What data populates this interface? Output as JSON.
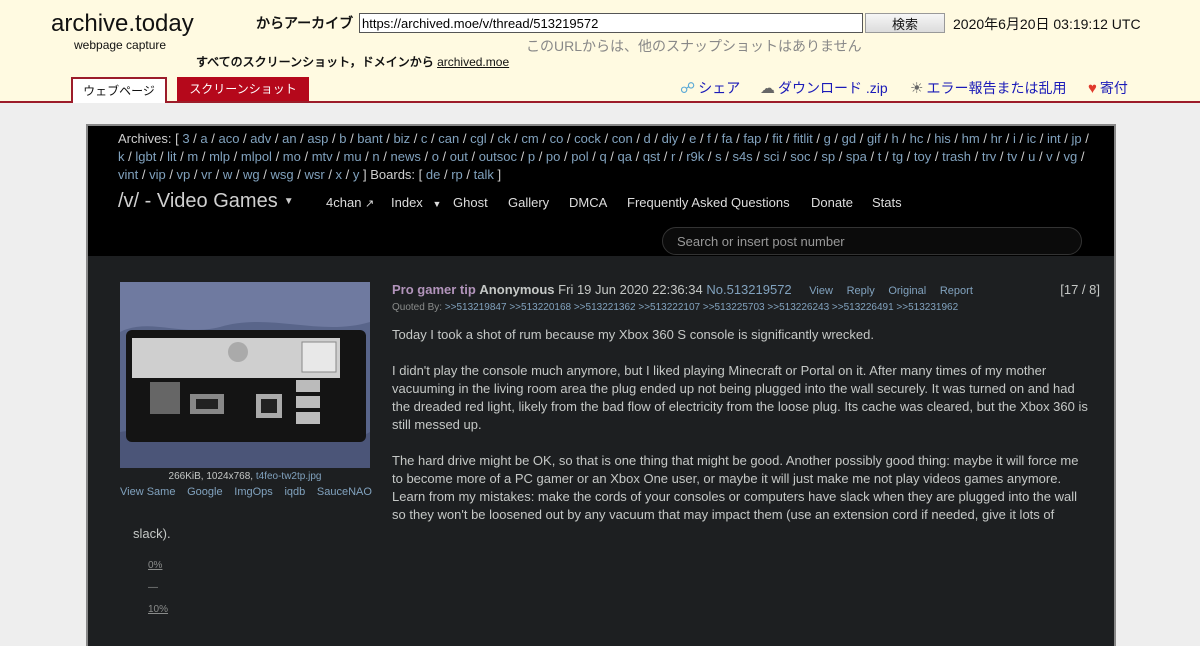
{
  "header": {
    "logo": "archive.today",
    "sublogo": "webpage capture",
    "from_label": "からアーカイブ",
    "url": "https://archived.moe/v/thread/513219572",
    "search_button": "検索",
    "date": "2020年6月20日 03:19:12 UTC",
    "no_snapshots": "このURLからは、他のスナップショットはありません",
    "all_shots_label": "すべてのスクリーンショット，ドメインから",
    "all_shots_domain": "archived.moe",
    "tabs": {
      "webpage": "ウェブページ",
      "screenshot": "スクリーンショット"
    },
    "links": {
      "share": "シェア",
      "download": "ダウンロード .zip",
      "report": "エラー報告または乱用",
      "donate": "寄付"
    }
  },
  "archive": {
    "archives_prefix": "Archives: [",
    "archives": [
      "3",
      "a",
      "aco",
      "adv",
      "an",
      "asp",
      "b",
      "bant",
      "biz",
      "c",
      "can",
      "cgl",
      "ck",
      "cm",
      "co",
      "cock",
      "con",
      "d",
      "diy",
      "e",
      "f",
      "fa",
      "fap",
      "fit",
      "fitlit",
      "g",
      "gd",
      "gif",
      "h",
      "hc",
      "his",
      "hm",
      "hr",
      "i",
      "ic",
      "int",
      "jp",
      "k",
      "lgbt",
      "lit",
      "m",
      "mlp",
      "mlpol",
      "mo",
      "mtv",
      "mu",
      "n",
      "news",
      "o",
      "out",
      "outsoc",
      "p",
      "po",
      "pol",
      "q",
      "qa",
      "qst",
      "r",
      "r9k",
      "s",
      "s4s",
      "sci",
      "soc",
      "sp",
      "spa",
      "t",
      "tg",
      "toy",
      "trash",
      "trv",
      "tv",
      "u",
      "v",
      "vg",
      "vint",
      "vip",
      "vp",
      "vr",
      "w",
      "wg",
      "wsg",
      "wsr",
      "x",
      "y"
    ],
    "boards_prefix": "] Boards: [",
    "boards": [
      "de",
      "rp",
      "talk"
    ],
    "boards_suffix": "]",
    "board_title": "/v/ - Video Games",
    "nav": [
      "4chan",
      "Index",
      "Ghost",
      "Gallery",
      "DMCA",
      "Frequently Asked Questions",
      "Donate",
      "Stats"
    ],
    "search_placeholder": "Search or insert post number"
  },
  "post": {
    "file_meta": "266KiB, 1024x768,",
    "file_name": "t4feo-tw2tp.jpg",
    "image_links": [
      "View Same",
      "Google",
      "ImgOps",
      "iqdb",
      "SauceNAO"
    ],
    "subject": "Pro gamer tip",
    "name": "Anonymous",
    "date": "Fri 19 Jun 2020 22:36:34",
    "number": "No.513219572",
    "actions": [
      "View",
      "Reply",
      "Original",
      "Report"
    ],
    "counter": "[17 / 8]",
    "quoted_by_label": "Quoted By:",
    "quoted_by": [
      ">>513219847",
      ">>513220168",
      ">>513221362",
      ">>513222107",
      ">>513225703",
      ">>513226243",
      ">>513226491",
      ">>513231962"
    ],
    "paragraphs": [
      "Today I took a shot of rum because my Xbox 360 S console is significantly wrecked.",
      "I didn't play the console much anymore, but I liked playing Minecraft or Portal on it. After many times of my mother vacuuming in the living room area the plug ended up not being plugged into the wall securely. It was turned on and had the dreaded red light, likely from the bad flow of electricity from the loose plug. Its cache was cleared, but the Xbox 360 is still messed up.",
      "The hard drive might be OK, so that is one thing that might be good. Another possibly good thing: maybe it will force me to become more of a PC gamer or an Xbox One user, or maybe it will just make me not play videos games anymore. Learn from my mistakes: make the cords of your consoles or computers have slack when they are plugged into the wall so they won't be loosened out by any vacuum that may impact them (use an extension cord if needed, give it lots of"
    ],
    "tail": "slack).",
    "pct_top": "0%",
    "pct_mid": "—",
    "pct_bottom": "10%"
  }
}
